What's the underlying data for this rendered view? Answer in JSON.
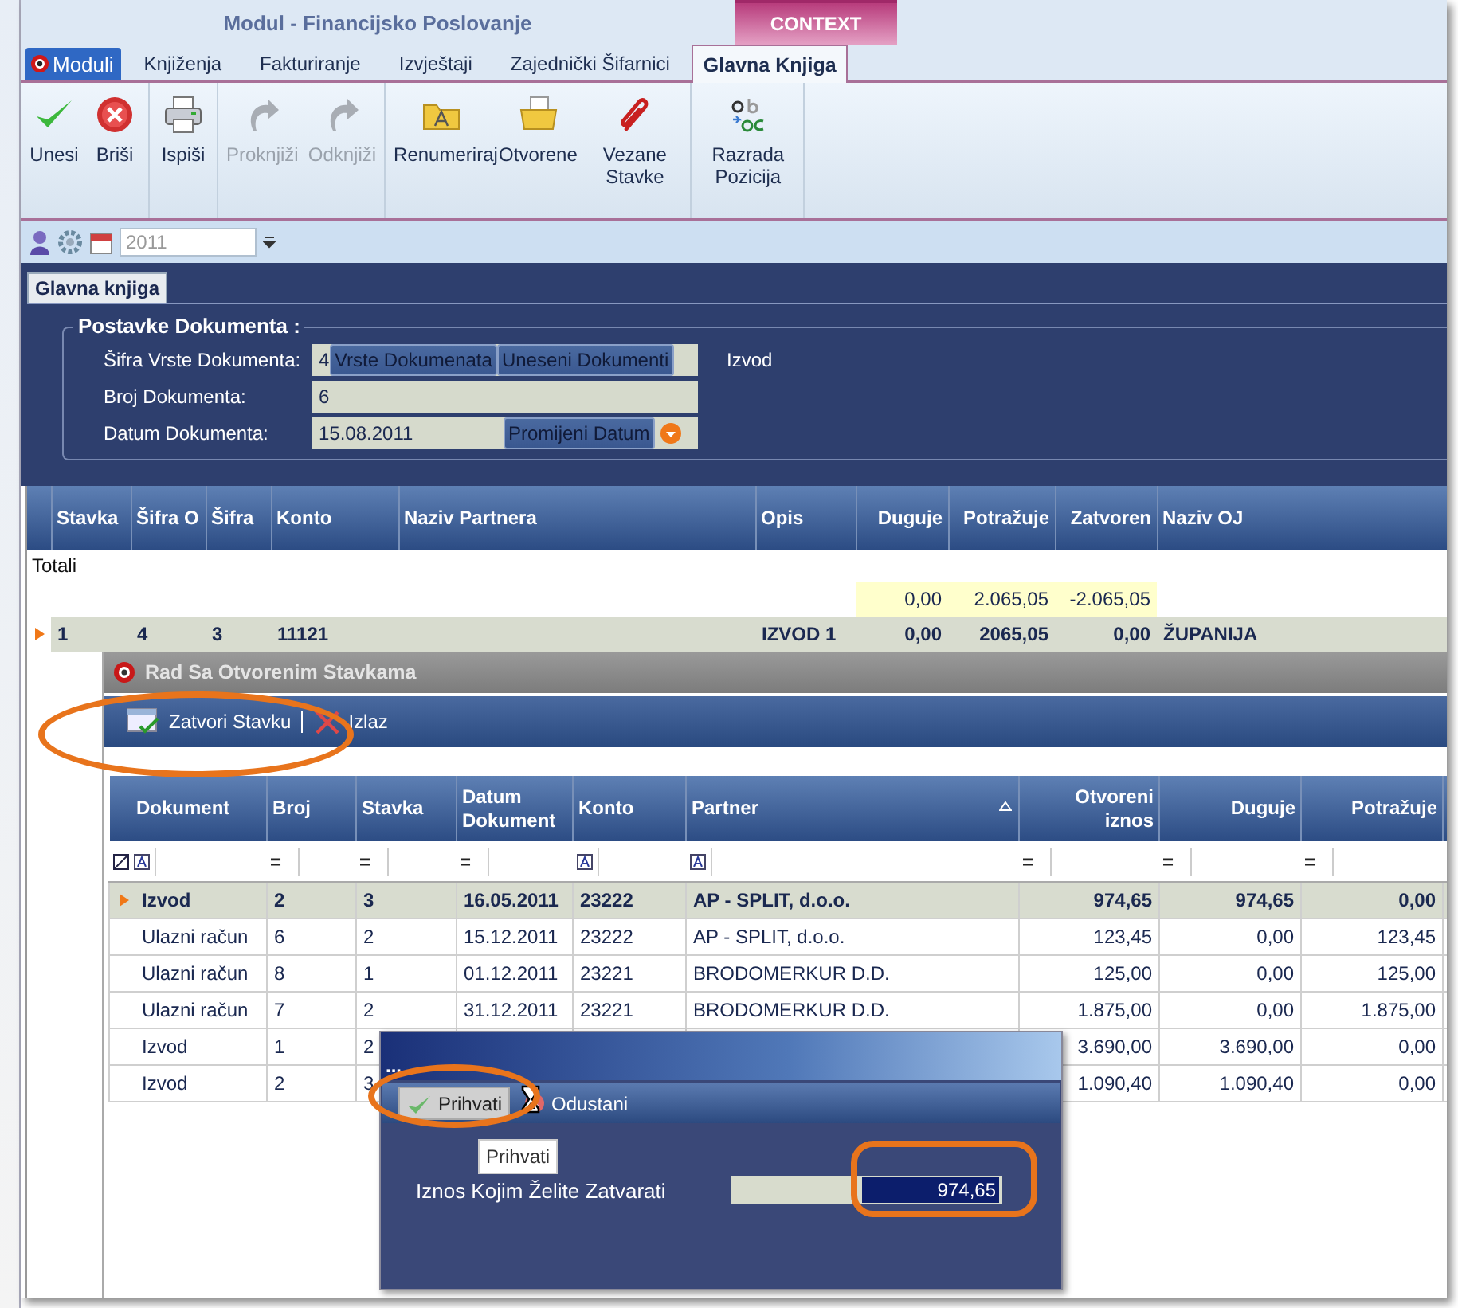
{
  "window": {
    "title": "Modul - Financijsko Poslovanje",
    "context_label": "CONTEXT"
  },
  "menu_tabs": [
    {
      "label": "Moduli",
      "kind": "app",
      "selected": false
    },
    {
      "label": "Knjiženja",
      "kind": "tab",
      "selected": false
    },
    {
      "label": "Fakturiranje",
      "kind": "tab",
      "selected": false
    },
    {
      "label": "Izvještaji",
      "kind": "tab",
      "selected": false
    },
    {
      "label": "Zajednički Šifarnici",
      "kind": "tab",
      "selected": false
    },
    {
      "label": "Glavna Knjiga",
      "kind": "tab",
      "selected": true
    }
  ],
  "ribbon": {
    "groups": [
      {
        "buttons": [
          {
            "label": "Unesi",
            "kind": "check",
            "disabled": false
          },
          {
            "label": "Briši",
            "kind": "delete",
            "disabled": false
          }
        ]
      },
      {
        "buttons": [
          {
            "label": "Ispiši",
            "kind": "print",
            "disabled": false
          }
        ]
      },
      {
        "buttons": [
          {
            "label": "Proknjiži",
            "kind": "redo",
            "disabled": true
          },
          {
            "label": "Odknjiži",
            "kind": "redo",
            "disabled": true
          }
        ]
      },
      {
        "buttons": [
          {
            "label": "Renumeriraj",
            "kind": "folder-a",
            "disabled": false
          },
          {
            "label": "Otvorene",
            "kind": "folder-doc",
            "disabled": false
          },
          {
            "label": "Vezane Stavke",
            "kind": "clip",
            "disabled": false
          }
        ]
      },
      {
        "buttons": [
          {
            "label": "Razrada Pozicija",
            "kind": "letters",
            "disabled": false
          }
        ]
      }
    ]
  },
  "quick_bar": {
    "year": "2011"
  },
  "doc_tab": {
    "label": "Glavna knjiga"
  },
  "settings": {
    "title": "Postavke Dokumenta :",
    "fields": [
      {
        "label": "Šifra Vrste Dokumenta:",
        "value": "4",
        "buttons": [
          "Vrste Dokumenata",
          "Uneseni Dokumenti"
        ],
        "note": "Izvod"
      },
      {
        "label": "Broj Dokumenta:",
        "value": "6"
      },
      {
        "label": "Datum Dokumenta:",
        "value": "15.08.2011",
        "buttons": [
          "Promijeni Datum"
        ],
        "dropdown": true
      }
    ]
  },
  "main_grid": {
    "columns": [
      {
        "label": "Stavka",
        "numeric": false
      },
      {
        "label": "Šifra O",
        "numeric": false
      },
      {
        "label": "Šifra",
        "numeric": false
      },
      {
        "label": "Konto",
        "numeric": false
      },
      {
        "label": "Naziv Partnera",
        "numeric": false
      },
      {
        "label": "Opis",
        "numeric": false
      },
      {
        "label": "Duguje",
        "numeric": true,
        "total": "0,00"
      },
      {
        "label": "Potražuje",
        "numeric": true,
        "total": "2.065,05"
      },
      {
        "label": "Zatvoren",
        "numeric": true,
        "total": "-2.065,05"
      },
      {
        "label": "Naziv OJ",
        "numeric": false
      }
    ],
    "totals_label": "Totali",
    "rows": [
      {
        "cells": [
          "1",
          "4",
          "3",
          "11121",
          null,
          "IZVOD 1",
          "0,00",
          "2065,05",
          "0,00",
          "ŽUPANIJA"
        ],
        "selected": true
      }
    ]
  },
  "open_items": {
    "title": "Rad Sa Otvorenim Stavkama",
    "toolbar": [
      {
        "label": "Zatvori Stavku",
        "kind": "close-item"
      },
      {
        "label": "Izlaz",
        "kind": "exit"
      }
    ],
    "columns": [
      {
        "label": "Dokument",
        "numeric": false,
        "sorted": false
      },
      {
        "label": "Broj",
        "numeric": false,
        "sorted": false
      },
      {
        "label": "Stavka",
        "numeric": false,
        "sorted": false
      },
      {
        "label": "Datum Dokument",
        "numeric": false,
        "sorted": false
      },
      {
        "label": "Konto",
        "numeric": false,
        "sorted": false
      },
      {
        "label": "Partner",
        "numeric": false,
        "sorted": true
      },
      {
        "label": "Otvoreni iznos",
        "numeric": true,
        "sorted": false
      },
      {
        "label": "Duguje",
        "numeric": true,
        "sorted": false
      },
      {
        "label": "Potražuje",
        "numeric": true,
        "sorted": false
      }
    ],
    "filters": [
      {
        "kind": "text"
      },
      {
        "kind": "equals",
        "operator": "="
      },
      {
        "kind": "equals",
        "operator": "="
      },
      {
        "kind": "equals",
        "operator": "="
      },
      {
        "kind": "text"
      },
      {
        "kind": "text"
      },
      {
        "kind": "equals",
        "operator": "="
      },
      {
        "kind": "equals",
        "operator": "="
      },
      {
        "kind": "equals",
        "operator": "="
      }
    ],
    "rows": [
      {
        "cells": [
          "Izvod",
          "2",
          "3",
          "16.05.2011",
          "23222",
          "AP - SPLIT, d.o.o.",
          "974,65",
          "974,65",
          "0,00"
        ],
        "selected": true
      },
      {
        "cells": [
          "Ulazni račun",
          "6",
          "2",
          "15.12.2011",
          "23222",
          "AP - SPLIT, d.o.o.",
          "123,45",
          "0,00",
          "123,45"
        ],
        "selected": false
      },
      {
        "cells": [
          "Ulazni račun",
          "8",
          "1",
          "01.12.2011",
          "23221",
          "BRODOMERKUR D.D.",
          "125,00",
          "0,00",
          "125,00"
        ],
        "selected": false
      },
      {
        "cells": [
          "Ulazni račun",
          "7",
          "2",
          "31.12.2011",
          "23221",
          "BRODOMERKUR D.D.",
          "1.875,00",
          "0,00",
          "1.875,00"
        ],
        "selected": false
      },
      {
        "cells": [
          "Izvod",
          "1",
          "2",
          null,
          null,
          null,
          "3.690,00",
          "3.690,00",
          "0,00"
        ],
        "selected": false
      },
      {
        "cells": [
          "Izvod",
          "2",
          "3",
          null,
          null,
          null,
          "1.090,40",
          "1.090,40",
          "0,00"
        ],
        "selected": false
      }
    ]
  },
  "dialog": {
    "title": "...",
    "buttons": [
      {
        "label": "Prihvati",
        "kind": "accept",
        "hovered": true
      },
      {
        "label": "Odustani",
        "kind": "cancel",
        "hovered": false
      }
    ],
    "tooltip": "Prihvati",
    "field_label": "Iznos Kojim Želite Zatvarati",
    "value": "974,65"
  }
}
